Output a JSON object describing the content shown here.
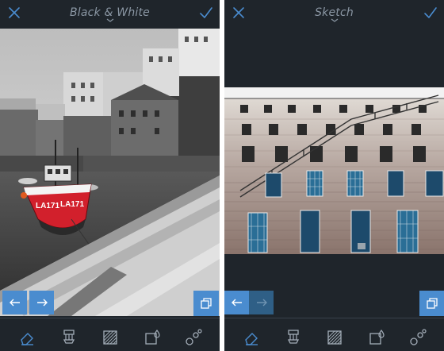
{
  "colors": {
    "panel_bg": "#1f252b",
    "accent": "#4a8ccf",
    "title": "#8a96a3",
    "icon": "#a3adb8"
  },
  "left_panel": {
    "title": "Black & White",
    "close_icon": "close-icon",
    "done_icon": "checkmark-icon",
    "title_menu_icon": "chevron-down-icon",
    "back_arrow": "←",
    "forward_arrow": "→",
    "compare_icon": "compare-icon",
    "boat_name": "LA171"
  },
  "right_panel": {
    "title": "Sketch",
    "close_icon": "close-icon",
    "done_icon": "checkmark-icon",
    "title_menu_icon": "chevron-down-icon",
    "back_arrow": "←",
    "forward_arrow": "→",
    "compare_icon": "compare-icon"
  },
  "toolbar": {
    "tools": [
      "eraser-icon",
      "brush-icon",
      "fill-pattern-icon",
      "drop-icon",
      "bubbles-icon"
    ],
    "selected": "eraser-icon"
  }
}
